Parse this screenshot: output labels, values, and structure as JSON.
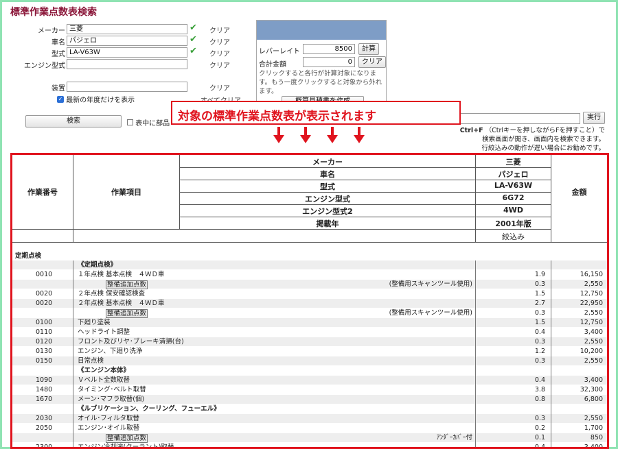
{
  "title": "標準作業点数表検索",
  "form": {
    "fields": [
      {
        "label": "メーカー",
        "value": "三菱",
        "checked": true,
        "clear": "クリア"
      },
      {
        "label": "車名",
        "value": "パジェロ",
        "checked": true,
        "clear": "クリア"
      },
      {
        "label": "型式",
        "value": "LA-V63W",
        "checked": true,
        "clear": "クリア"
      },
      {
        "label": "エンジン型式",
        "value": "",
        "checked": false,
        "clear": "クリア"
      },
      {
        "label": "装置",
        "value": "",
        "checked": false,
        "clear": "クリア"
      }
    ],
    "latest_year_label": "最新の年度だけを表示",
    "latest_year_checked": true,
    "clear_all": "すべてクリア",
    "search_button": "検索",
    "in_table_label": "表中に部品"
  },
  "calc": {
    "lever_rate_label": "レバーレイト",
    "lever_rate_value": "8500",
    "calc_button": "計算",
    "total_label": "合計金額",
    "total_value": "0",
    "clear_button": "クリア",
    "note": "クリックすると各行が計算対象になります。もう一度クリックすると対象から外れます。",
    "estimate_button": "概算見積書を作成"
  },
  "find": {
    "run_button": "実行",
    "hint_key": "Ctrl+F",
    "hint_1": "（Ctrlキーを押しながらFを押すこと）で",
    "hint_2": "検索画面が開き、画面内を検索できます。",
    "hint_3": "行絞込みの動作が遅い場合にお勧めです。"
  },
  "callout": "対象の標準作業点数表が表示されます",
  "table": {
    "col_no": "作業番号",
    "col_item": "作業項目",
    "col_amount": "金額",
    "spec": [
      {
        "label": "メーカー",
        "value": "三菱"
      },
      {
        "label": "車名",
        "value": "パジェロ"
      },
      {
        "label": "型式",
        "value": "LA-V63W"
      },
      {
        "label": "エンジン型式",
        "value": "6G72"
      },
      {
        "label": "エンジン型式2",
        "value": "4WD"
      },
      {
        "label": "掲載年",
        "value": "2001年版"
      }
    ],
    "filter_label": "絞込み",
    "section": "定期点検",
    "rows": [
      {
        "no": "",
        "item": "《定期点検》",
        "tag": "",
        "note": "",
        "pts": "",
        "amt": "",
        "bold": true
      },
      {
        "no": "0010",
        "item": "１年点検 基本点検　４ＷＤ車",
        "tag": "",
        "note": "",
        "pts": "1.9",
        "amt": "16,150"
      },
      {
        "no": "",
        "item": "",
        "tag": "整備追加点数",
        "note": "(整備用スキャンツール使用)",
        "pts": "0.3",
        "amt": "2,550"
      },
      {
        "no": "0020",
        "item": "２年点検 保安確認検査",
        "tag": "",
        "note": "",
        "pts": "1.5",
        "amt": "12,750"
      },
      {
        "no": "0020",
        "item": "２年点検 基本点検　４ＷＤ車",
        "tag": "",
        "note": "",
        "pts": "2.7",
        "amt": "22,950"
      },
      {
        "no": "",
        "item": "",
        "tag": "整備追加点数",
        "note": "(整備用スキャンツール使用)",
        "pts": "0.3",
        "amt": "2,550"
      },
      {
        "no": "0100",
        "item": "下廻り塗装",
        "tag": "",
        "note": "",
        "pts": "1.5",
        "amt": "12,750"
      },
      {
        "no": "0110",
        "item": "ヘッドライト調整",
        "tag": "",
        "note": "",
        "pts": "0.4",
        "amt": "3,400"
      },
      {
        "no": "0120",
        "item": "フロント及びリヤ･ブレーキ清掃(台)",
        "tag": "",
        "note": "",
        "pts": "0.3",
        "amt": "2,550"
      },
      {
        "no": "0130",
        "item": "エンジン、下廻り洗浄",
        "tag": "",
        "note": "",
        "pts": "1.2",
        "amt": "10,200"
      },
      {
        "no": "0150",
        "item": "日常点検",
        "tag": "",
        "note": "",
        "pts": "0.3",
        "amt": "2,550"
      },
      {
        "no": "",
        "item": "《エンジン本体》",
        "tag": "",
        "note": "",
        "pts": "",
        "amt": "",
        "bold": true
      },
      {
        "no": "1090",
        "item": "Ｖベルト全数取替",
        "tag": "",
        "note": "",
        "pts": "0.4",
        "amt": "3,400"
      },
      {
        "no": "1480",
        "item": "タイミング･ベルト取替",
        "tag": "",
        "note": "",
        "pts": "3.8",
        "amt": "32,300"
      },
      {
        "no": "1670",
        "item": "メーン･マフラ取替(個)",
        "tag": "",
        "note": "",
        "pts": "0.8",
        "amt": "6,800"
      },
      {
        "no": "",
        "item": "《ルブリケーション、クーリング、フューエル》",
        "tag": "",
        "note": "",
        "pts": "",
        "amt": "",
        "bold": true
      },
      {
        "no": "2030",
        "item": "オイル･フィルタ取替",
        "tag": "",
        "note": "",
        "pts": "0.3",
        "amt": "2,550"
      },
      {
        "no": "2050",
        "item": "エンジン･オイル取替",
        "tag": "",
        "note": "",
        "pts": "0.2",
        "amt": "1,700"
      },
      {
        "no": "",
        "item": "",
        "tag": "整備追加点数",
        "note": "ｱﾝﾀﾞｰｶﾊﾞｰ付",
        "pts": "0.1",
        "amt": "850"
      },
      {
        "no": "2300",
        "item": "エンジン冷却液(クーラント)取替",
        "tag": "",
        "note": "",
        "pts": "0.4",
        "amt": "3,400"
      }
    ]
  },
  "colors": {
    "accent": "#8a1538",
    "callout": "#e0141e",
    "check": "#3aa03a",
    "panel": "#7e9dc6"
  }
}
